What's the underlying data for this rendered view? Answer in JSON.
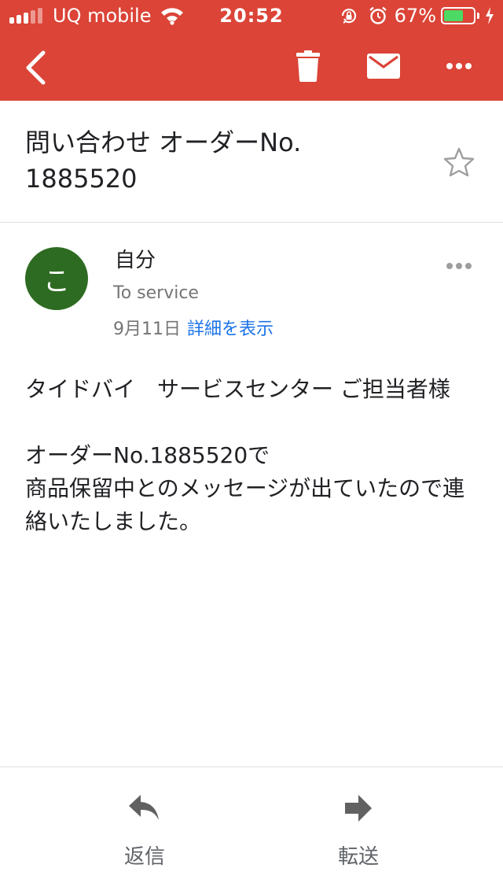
{
  "status_bar": {
    "carrier": "UQ mobile",
    "time": "20:52",
    "battery_percent": "67%",
    "battery_level": 0.67,
    "icons": [
      "signal-icon",
      "wifi-icon",
      "orientation-lock-icon",
      "alarm-icon",
      "battery-icon",
      "charging-icon"
    ]
  },
  "app_bar": {
    "icons": [
      "back-arrow-icon",
      "trash-icon",
      "mail-icon",
      "more-icon"
    ]
  },
  "email": {
    "subject": "問い合わせ オーダーNo.\n1885520",
    "starred": false,
    "sender_initial": "こ",
    "sender": "自分",
    "to": "To service",
    "date": "9月11日",
    "details_link": "詳細を表示",
    "body": [
      "タイドバイ　サービスセンター ご担当者様",
      "オーダーNo.1885520で\n商品保留中とのメッセージが出ていたので連絡いたしました。"
    ]
  },
  "bottom_bar": {
    "reply_label": "返信",
    "forward_label": "転送"
  },
  "colors": {
    "header": "#db4437",
    "avatar": "#2e6b22",
    "link": "#1a73e8",
    "battery_fill": "#4cd964"
  }
}
